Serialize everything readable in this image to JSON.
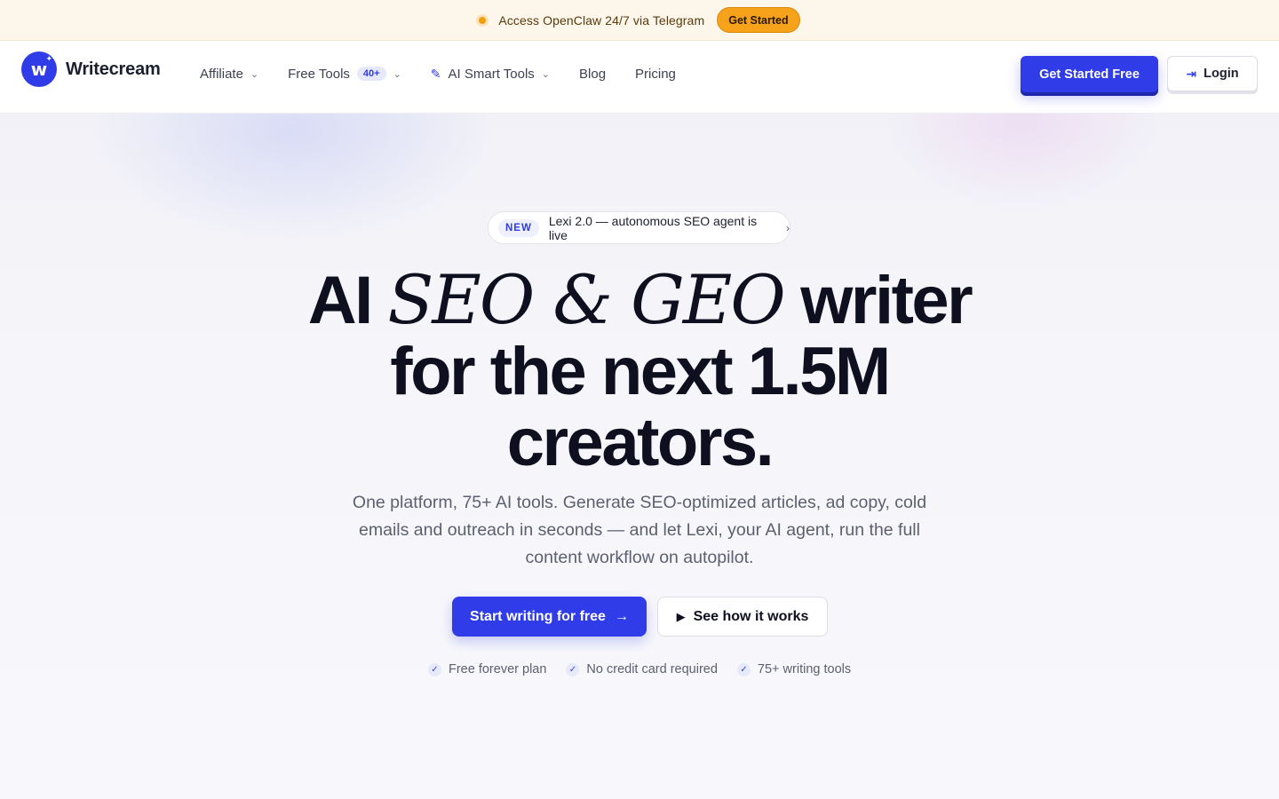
{
  "announcement": {
    "message": "Access OpenClaw 24/7 via Telegram",
    "cta": "Get Started"
  },
  "brand": {
    "name": "Writecream",
    "mark": "w",
    "color": "#2f3ce8"
  },
  "nav": {
    "items": [
      {
        "label": "Affiliate",
        "has_dropdown": true
      },
      {
        "label": "Free Tools",
        "badge": "40+",
        "has_dropdown": true
      },
      {
        "label": "AI Smart Tools",
        "icon": "magic-wand-icon",
        "has_dropdown": true
      },
      {
        "label": "Blog"
      },
      {
        "label": "Pricing"
      }
    ],
    "primary_cta": "Get Started Free",
    "login": "Login"
  },
  "hero": {
    "pill_tag": "NEW",
    "pill_text": "Lexi 2.0 — autonomous SEO agent is live",
    "headline_ai": "AI",
    "headline_serif": "SEO & GEO",
    "headline_writer": "writer",
    "headline_line2": "for the next 1.5M",
    "headline_line3": "creators.",
    "subtext": "One platform, 75+ AI tools. Generate SEO-optimized articles, ad copy, cold emails and outreach in seconds — and let Lexi, your AI agent, run the full content workflow on autopilot.",
    "cta_start": "Start writing for free",
    "cta_how": "See how it works",
    "checks": [
      "Free forever plan",
      "No credit card required",
      "75+ writing tools"
    ]
  },
  "colors": {
    "accent": "#2f3ce8",
    "announce_bg": "#fdf6ea",
    "announce_button": "#f7a21b"
  }
}
